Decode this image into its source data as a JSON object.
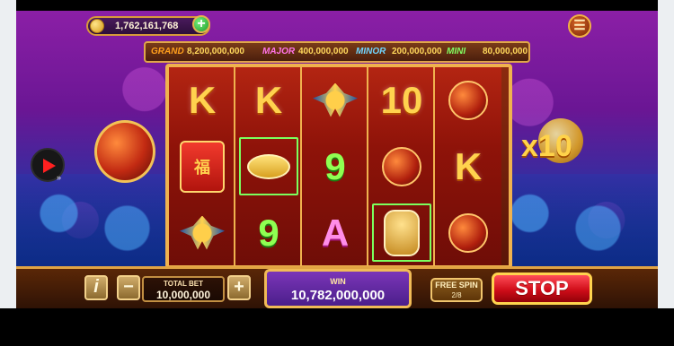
{
  "header": {
    "coin_balance": "1,762,161,768",
    "plus_label": "+",
    "menu_label": "☰"
  },
  "jackpots": [
    {
      "name": "GRAND",
      "value": "8,200,000,000"
    },
    {
      "name": "MAJOR",
      "value": "400,000,000"
    },
    {
      "name": "MINOR",
      "value": "200,000,000"
    },
    {
      "name": "MINI",
      "value": "80,000,000"
    }
  ],
  "reels": [
    [
      "K",
      "福",
      ""
    ],
    [
      "K",
      "",
      "9"
    ],
    [
      "",
      "9",
      "A"
    ],
    [
      "10",
      "",
      ""
    ],
    [
      "",
      "K",
      ""
    ]
  ],
  "side": {
    "multiplier": "x10"
  },
  "bottom_bar": {
    "info": "i",
    "minus": "−",
    "total_bet_label": "TOTAL BET",
    "total_bet_value": "10,000,000",
    "plus": "+",
    "win_label": "WIN",
    "win_value": "10,782,000,000",
    "free_spin_label": "FREE SPIN",
    "free_spin_count": "2/8",
    "stop_label": "STOP"
  }
}
